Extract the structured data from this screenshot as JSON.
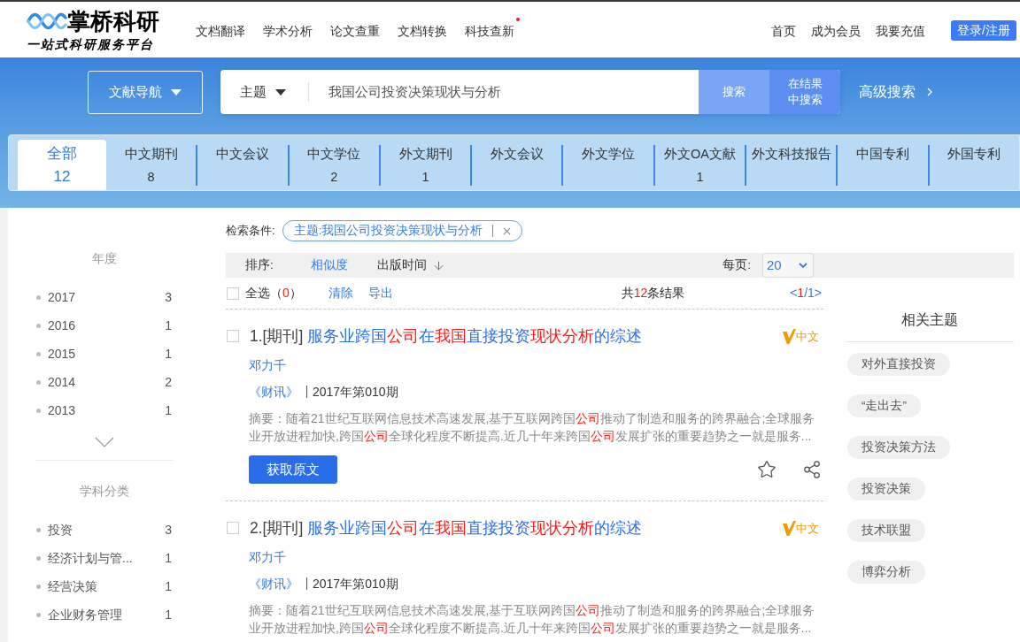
{
  "header": {
    "logo": {
      "title": "掌桥科研",
      "slogan": "一站式科研服务平台"
    },
    "nav": [
      {
        "label": "文档翻译",
        "new": false
      },
      {
        "label": "学术分析",
        "new": false
      },
      {
        "label": "论文查重",
        "new": false
      },
      {
        "label": "文档转换",
        "new": false
      },
      {
        "label": "科技查新",
        "new": true
      }
    ],
    "links": [
      "首页",
      "成为会员",
      "我要充值"
    ],
    "login_button": "登录/注册"
  },
  "search": {
    "nav_button": "文献导航",
    "field": "主题",
    "query": "我国公司投资决策现状与分析",
    "search_button": "搜索",
    "search_within_button": "在结果中搜索",
    "advanced_search": "高级搜索"
  },
  "tabs": [
    {
      "label": "全部",
      "count": "12",
      "selected": true
    },
    {
      "label": "中文期刊",
      "count": "8",
      "selected": false
    },
    {
      "label": "中文会议",
      "selected": false
    },
    {
      "label": "中文学位",
      "count": "2",
      "selected": false
    },
    {
      "label": "外文期刊",
      "count": "1",
      "selected": false
    },
    {
      "label": "外文会议",
      "selected": false
    },
    {
      "label": "外文学位",
      "selected": false
    },
    {
      "label": "外文OA文献",
      "count": "1",
      "selected": false
    },
    {
      "label": "外文科技报告",
      "selected": false
    },
    {
      "label": "中国专利",
      "selected": false
    },
    {
      "label": "外国专利",
      "selected": false
    }
  ],
  "filters": [
    {
      "title": "年度",
      "has_more": true,
      "items": [
        {
          "label": "2017",
          "count": "3"
        },
        {
          "label": "2016",
          "count": "1"
        },
        {
          "label": "2015",
          "count": "1"
        },
        {
          "label": "2014",
          "count": "2"
        },
        {
          "label": "2013",
          "count": "1"
        }
      ]
    },
    {
      "title": "学科分类",
      "items": [
        {
          "label": "投资",
          "count": "3"
        },
        {
          "label": "经济计划与管...",
          "count": "1"
        },
        {
          "label": "经营决策",
          "count": "1"
        },
        {
          "label": "企业财务管理",
          "count": "1"
        }
      ]
    }
  ],
  "conditions": {
    "label": "检索条件:",
    "chip": "主题:我国公司投资决策现状与分析"
  },
  "sort": {
    "label": "排序:",
    "options": [
      {
        "label": "相似度",
        "selected": true
      },
      {
        "label": "出版时间",
        "selected": false
      }
    ],
    "per_page_label": "每页:",
    "per_page": "20"
  },
  "toolbar": {
    "checked": false,
    "select_all": [
      {
        "text": "全选（",
        "highlight": false
      },
      {
        "text": "0",
        "highlight": true
      },
      {
        "text": "）",
        "highlight": false
      }
    ],
    "clear": "清除",
    "export": "导出",
    "total": [
      {
        "text": "共",
        "highlight": false
      },
      {
        "text": "12",
        "highlight": true
      },
      {
        "text": "条结果",
        "highlight": false
      }
    ],
    "pager": [
      {
        "text": "<",
        "highlight": false
      },
      {
        "text": "1",
        "highlight": true
      },
      {
        "text": "/1>",
        "highlight": false
      }
    ]
  },
  "results": [
    {
      "checked": false,
      "number": "1.",
      "type": "[期刊]",
      "title": [
        {
          "text": "服务业跨国",
          "highlight": false
        },
        {
          "text": "公司",
          "highlight": true
        },
        {
          "text": "在",
          "highlight": false
        },
        {
          "text": "我国",
          "highlight": true
        },
        {
          "text": "直接投资",
          "highlight": false
        },
        {
          "text": "现状分析",
          "highlight": true
        },
        {
          "text": "的综述",
          "highlight": false
        }
      ],
      "badge": "中文",
      "author": "邓力千",
      "source": "《财讯》",
      "issue": "2017年第010期",
      "abstract_label": "摘要：",
      "abstract": [
        {
          "text": "随着21世纪互联网信息技术高速发展,基于互联网跨国",
          "highlight": false
        },
        {
          "text": "公司",
          "highlight": true
        },
        {
          "text": "推动了制造和服务的跨界融合;全球服务业开放进程加快,跨国",
          "highlight": false
        },
        {
          "text": "公司",
          "highlight": true
        },
        {
          "text": "全球化程度不断提高.近几十年来跨国",
          "highlight": false
        },
        {
          "text": "公司",
          "highlight": true
        },
        {
          "text": "发展扩张的重要趋势之一就是服务...",
          "highlight": false
        }
      ],
      "button": "获取原文"
    },
    {
      "checked": false,
      "number": "2.",
      "type": "[期刊]",
      "title": [
        {
          "text": "服务业跨国",
          "highlight": false
        },
        {
          "text": "公司",
          "highlight": true
        },
        {
          "text": "在",
          "highlight": false
        },
        {
          "text": "我国",
          "highlight": true
        },
        {
          "text": "直接投资",
          "highlight": false
        },
        {
          "text": "现状分析",
          "highlight": true
        },
        {
          "text": "的综述",
          "highlight": false
        }
      ],
      "badge": "中文",
      "author": "邓力千",
      "source": "《财讯》",
      "issue": "2017年第010期",
      "abstract_label": "摘要：",
      "abstract": [
        {
          "text": "随着21世纪互联网信息技术高速发展,基于互联网跨国",
          "highlight": false
        },
        {
          "text": "公司",
          "highlight": true
        },
        {
          "text": "推动了制造和服务的跨界融合;全球服务业开放进程加快,跨国",
          "highlight": false
        },
        {
          "text": "公司",
          "highlight": true
        },
        {
          "text": "全球化程度不断提高.近几十年来跨国",
          "highlight": false
        },
        {
          "text": "公司",
          "highlight": true
        },
        {
          "text": "发展扩张的重要趋势之一就是服务...",
          "highlight": false
        }
      ]
    }
  ],
  "related": {
    "title": "相关主题",
    "tags": [
      "对外直接投资",
      "“走出去”",
      "投资决策方法",
      "投资决策",
      "技术联盟",
      "博弈分析"
    ]
  }
}
